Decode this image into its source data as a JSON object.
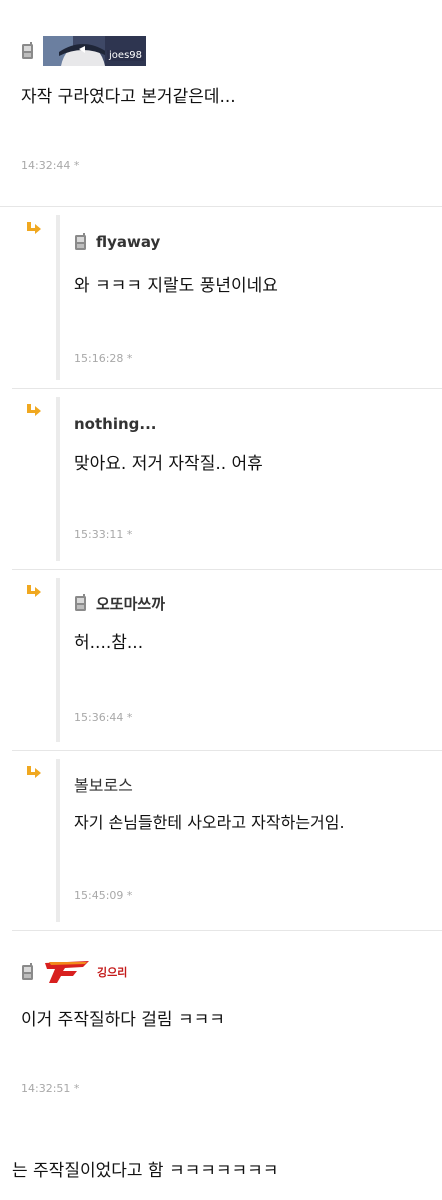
{
  "comments": [
    {
      "nick": "joes98",
      "text": "자작 구라였다고 본거같은데...",
      "time": "14:32:44 *"
    },
    {
      "nick": "flyaway",
      "text": "와 ㅋㅋㅋ 지랄도 풍년이네요",
      "time": "15:16:28 *"
    },
    {
      "nick": "nothing...",
      "text": "맞아요. 저거 자작질.. 어휴",
      "time": "15:33:11 *"
    },
    {
      "nick": "오또마쓰까",
      "text": "허....참...",
      "time": "15:36:44 *"
    },
    {
      "nick": "볼보로스",
      "text": "자기 손님들한테 사오라고 자작하는거임.",
      "time": "15:45:09 *"
    },
    {
      "nick": "깅으리",
      "text": "이거 주작질하다 걸림 ㅋㅋㅋ",
      "time": "14:32:51 *"
    }
  ],
  "footer_text": "는 주작질이었다고 함 ㅋㅋㅋㅋㅋㅋㅋ",
  "colors": {
    "reply_arrow": "#f0a820",
    "kim_name": "#c41919",
    "divider": "#e6e6e6"
  },
  "icons": {
    "mobile": "mobile-phone-icon",
    "reply": "reply-arrow-icon"
  }
}
